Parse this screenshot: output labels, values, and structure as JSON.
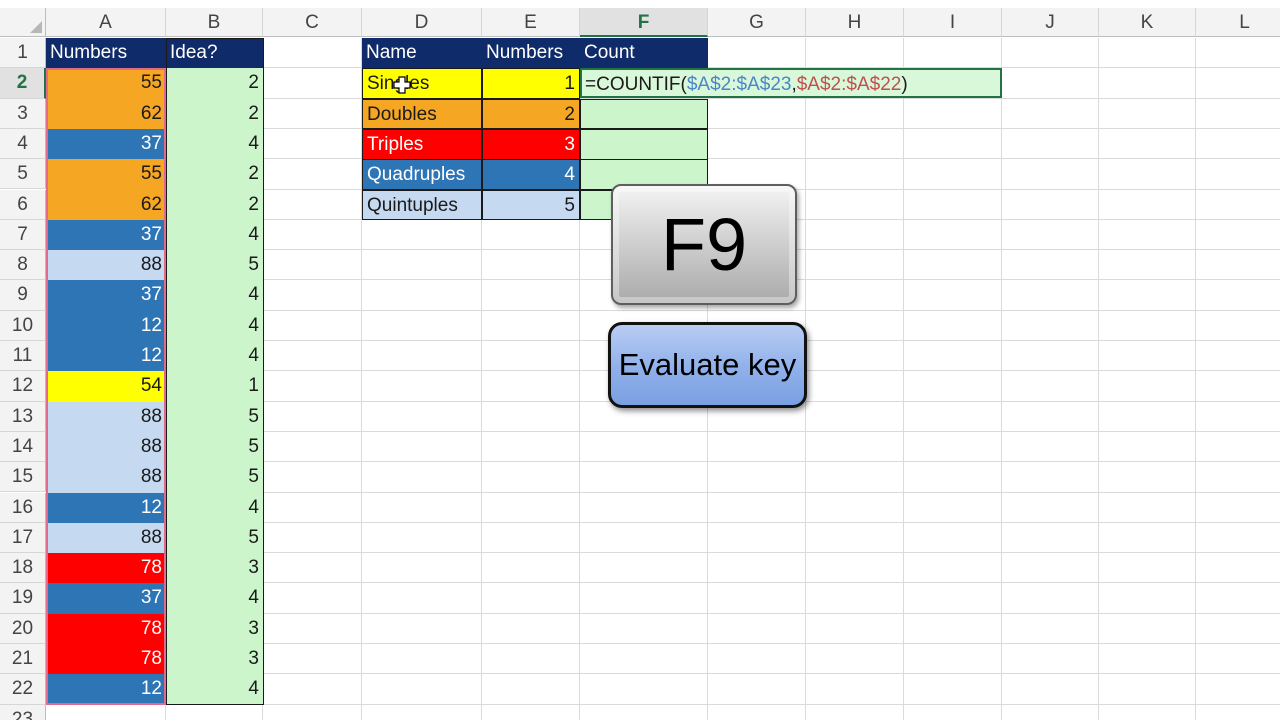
{
  "columns": [
    "A",
    "B",
    "C",
    "D",
    "E",
    "F",
    "G",
    "H",
    "I",
    "J",
    "K",
    "L"
  ],
  "selected_column": "F",
  "rows": [
    "1",
    "2",
    "3",
    "4",
    "5",
    "6",
    "7",
    "8",
    "9",
    "10",
    "11",
    "12",
    "13",
    "14",
    "15",
    "16",
    "17",
    "18",
    "19",
    "20",
    "21",
    "22",
    "23"
  ],
  "selected_row": "2",
  "table_left": {
    "headers": [
      "Numbers",
      "Idea?"
    ],
    "numbers": [
      "55",
      "62",
      "37",
      "55",
      "62",
      "37",
      "88",
      "37",
      "12",
      "12",
      "54",
      "88",
      "88",
      "88",
      "12",
      "88",
      "78",
      "37",
      "78",
      "78",
      "12"
    ],
    "ideas": [
      "2",
      "2",
      "4",
      "2",
      "2",
      "4",
      "5",
      "4",
      "4",
      "4",
      "1",
      "5",
      "5",
      "5",
      "4",
      "5",
      "3",
      "4",
      "3",
      "3",
      "4"
    ]
  },
  "table_right": {
    "headers": [
      "Name",
      "Numbers",
      "Count"
    ],
    "names": [
      "Singles",
      "Doubles",
      "Triples",
      "Quadruples",
      "Quintuples"
    ],
    "numbers": [
      "1",
      "2",
      "3",
      "4",
      "5"
    ]
  },
  "formula": {
    "prefix": "=COUNTIF(",
    "ref1": "$A$2:$A$23",
    "sep": ",",
    "ref2": "$A$2:$A$22",
    "suffix": ")"
  },
  "overlay": {
    "key_label": "F9",
    "caption": "Evaluate key"
  },
  "colors": {
    "header_fill": "#0f2b6a",
    "fill_1": "#ffff00",
    "fill_2": "#f5a623",
    "fill_3": "#ff0000",
    "fill_4": "#2e75b6",
    "fill_5": "#c5d9f1",
    "idea_fill": "#ccf5cc",
    "accent": "#217346"
  }
}
